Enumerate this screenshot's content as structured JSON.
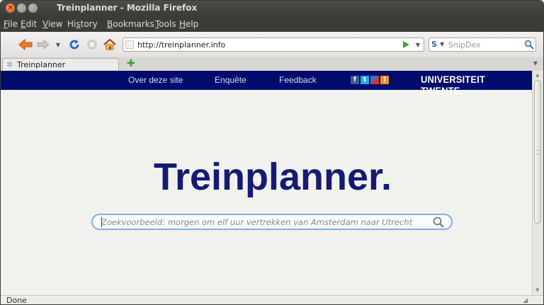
{
  "window": {
    "title": "Treinplanner - Mozilla Firefox"
  },
  "menubar": {
    "items": [
      {
        "label": "File",
        "accel": "F"
      },
      {
        "label": "Edit",
        "accel": "E"
      },
      {
        "label": "View",
        "accel": "V"
      },
      {
        "label": "History",
        "accel": "s"
      },
      {
        "label": "Bookmarks",
        "accel": "B"
      },
      {
        "label": "Tools",
        "accel": "T"
      },
      {
        "label": "Help",
        "accel": "H"
      }
    ]
  },
  "toolbar": {
    "url": "http://treinplanner.info",
    "search_engine_icon": "S",
    "search_placeholder": "SnipDex"
  },
  "tabs": [
    {
      "label": "Treinplanner"
    }
  ],
  "site": {
    "nav": [
      "Over deze site",
      "Enquête",
      "Feedback"
    ],
    "social_icons": [
      "facebook-icon",
      "twitter-icon",
      "delicious-icon",
      "rss-icon"
    ],
    "logo": "UNIVERSITEIT TWENTE.",
    "title": "Treinplanner.",
    "query_placeholder": "Zoekvoorbeeld: morgen om elf uur vertrekken van Amsterdam naar Utrecht"
  },
  "status": {
    "text": "Done"
  },
  "colors": {
    "site_header": "#020c6c",
    "title": "#151a73",
    "query_border": "#7fb0e0"
  }
}
